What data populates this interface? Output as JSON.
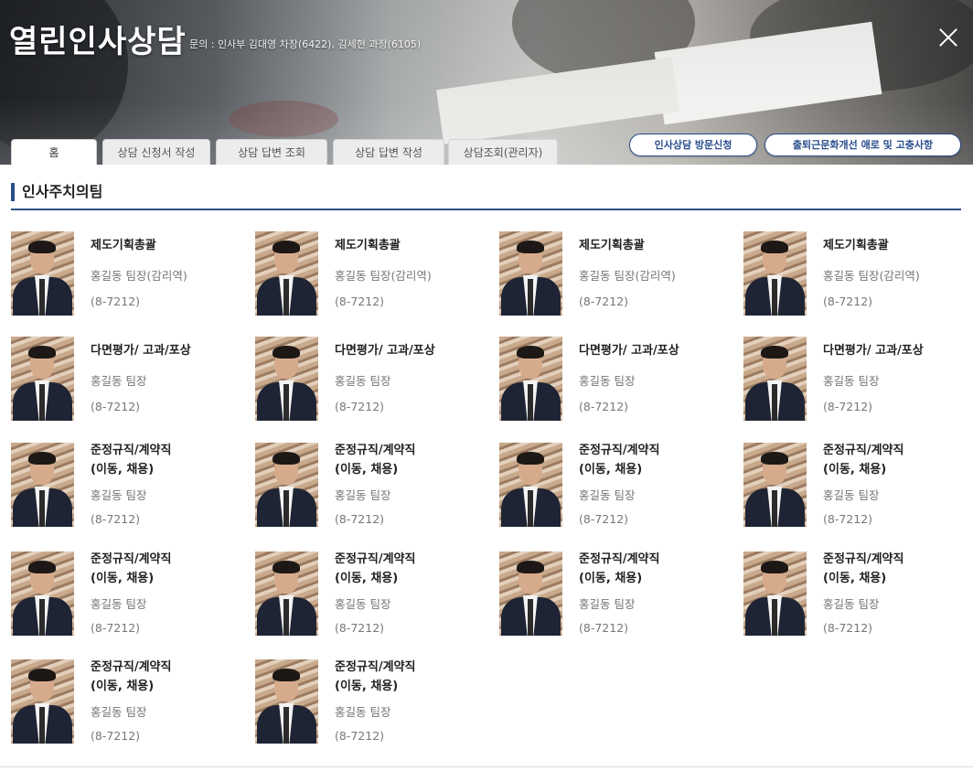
{
  "header": {
    "title": "열린인사상담",
    "contact": "문의 : 인사부 김대영 차장(6422), 김세현 과장(6105)"
  },
  "tabs": [
    {
      "label": "홈",
      "active": true
    },
    {
      "label": "상담 신청서 작성",
      "active": false
    },
    {
      "label": "상담 답변 조회",
      "active": false
    },
    {
      "label": "상담 답변 작성",
      "active": false
    },
    {
      "label": "상담조회(관리자)",
      "active": false
    }
  ],
  "actions": {
    "visit_request": "인사상담 방문신청",
    "culture_suggestion": "출퇴근문화개선 애로 및 고충사항"
  },
  "section": {
    "title": "인사주치의팀"
  },
  "cards": [
    {
      "role": "제도기획총괄",
      "name": "홍길동 팀장(감리역)",
      "phone": "(8-7212)"
    },
    {
      "role": "제도기획총괄",
      "name": "홍길동 팀장(감리역)",
      "phone": "(8-7212)"
    },
    {
      "role": "제도기획총괄",
      "name": "홍길동 팀장(감리역)",
      "phone": "(8-7212)"
    },
    {
      "role": "제도기획총괄",
      "name": "홍길동 팀장(감리역)",
      "phone": "(8-7212)"
    },
    {
      "role": "다면평가/ 고과/포상",
      "name": "홍길동 팀장",
      "phone": "(8-7212)"
    },
    {
      "role": "다면평가/ 고과/포상",
      "name": "홍길동 팀장",
      "phone": "(8-7212)"
    },
    {
      "role": "다면평가/ 고과/포상",
      "name": "홍길동 팀장",
      "phone": "(8-7212)"
    },
    {
      "role": "다면평가/ 고과/포상",
      "name": "홍길동 팀장",
      "phone": "(8-7212)"
    },
    {
      "role": "준정규직/계약직\n(이동, 채용)",
      "name": "홍길동 팀장",
      "phone": "(8-7212)"
    },
    {
      "role": "준정규직/계약직\n(이동, 채용)",
      "name": "홍길동 팀장",
      "phone": "(8-7212)"
    },
    {
      "role": "준정규직/계약직\n(이동, 채용)",
      "name": "홍길동 팀장",
      "phone": "(8-7212)"
    },
    {
      "role": "준정규직/계약직\n(이동, 채용)",
      "name": "홍길동 팀장",
      "phone": "(8-7212)"
    },
    {
      "role": "준정규직/계약직\n(이동, 채용)",
      "name": "홍길동 팀장",
      "phone": "(8-7212)"
    },
    {
      "role": "준정규직/계약직\n(이동, 채용)",
      "name": "홍길동 팀장",
      "phone": "(8-7212)"
    },
    {
      "role": "준정규직/계약직\n(이동, 채용)",
      "name": "홍길동 팀장",
      "phone": "(8-7212)"
    },
    {
      "role": "준정규직/계약직\n(이동, 채용)",
      "name": "홍길동 팀장",
      "phone": "(8-7212)"
    },
    {
      "role": "준정규직/계약직\n(이동, 채용)",
      "name": "홍길동 팀장",
      "phone": "(8-7212)"
    },
    {
      "role": "준정규직/계약직\n(이동, 채용)",
      "name": "홍길동 팀장",
      "phone": "(8-7212)"
    }
  ]
}
